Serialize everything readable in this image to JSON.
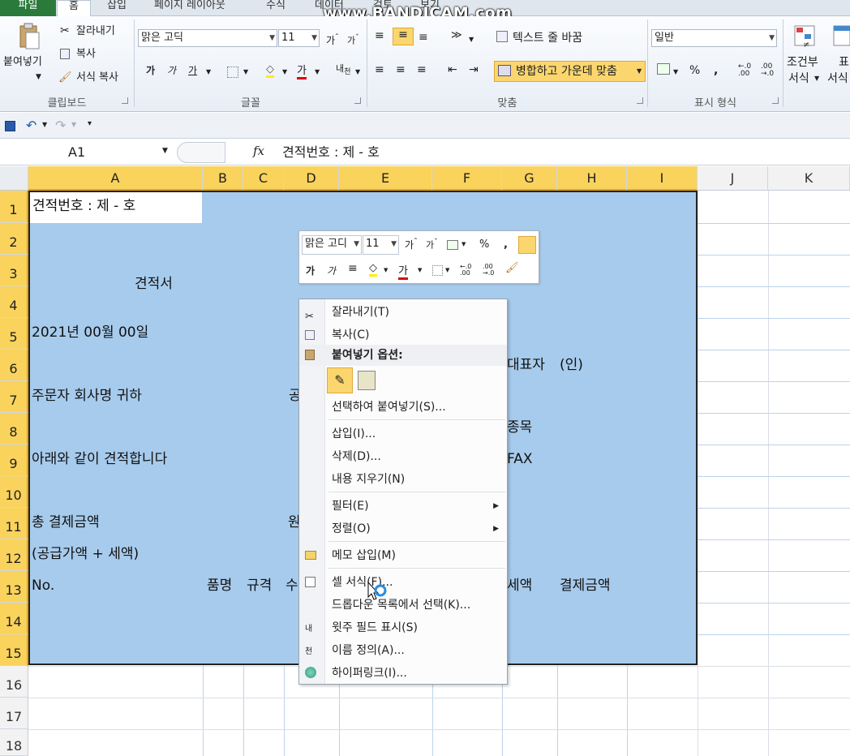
{
  "ribbon_tabs": [
    "파일",
    "홈",
    "삽입",
    "페이지 레이아웃",
    "수식",
    "데이터",
    "검토",
    "보기"
  ],
  "watermark": "www.BANDICAM.com",
  "clipboard": {
    "paste": "붙여넣기",
    "cut": "잘라내기",
    "copy": "복사",
    "format_painter": "서식 복사",
    "label": "클립보드"
  },
  "font": {
    "name": "맑은 고딕",
    "size": "11",
    "bold": "가",
    "italic": "가",
    "underline": "가",
    "label": "글꼴"
  },
  "alignment": {
    "wrap": "텍스트 줄 바꿈",
    "merge": "병합하고 가운데 맞춤",
    "label": "맞춤"
  },
  "number": {
    "format": "일반",
    "percent": "%",
    "comma": ",",
    "label": "표시 형식"
  },
  "styles": {
    "conditional_1": "조건부",
    "conditional_2": "서식",
    "table_1": "표",
    "table_2": "서식"
  },
  "name_box": "A1",
  "fx": "fx",
  "formula": "견적번호 : 제  -  호",
  "columns": [
    "A",
    "B",
    "C",
    "D",
    "E",
    "F",
    "G",
    "H",
    "I",
    "J",
    "K"
  ],
  "rows": [
    "1",
    "2",
    "3",
    "4",
    "5",
    "6",
    "7",
    "8",
    "9",
    "10",
    "11",
    "12",
    "13",
    "14",
    "15",
    "16",
    "17",
    "18"
  ],
  "cells": {
    "a1": "견적번호 : 제  -  호",
    "title": "견적서",
    "date": "2021년    00월    00일",
    "rep": "대표자",
    "seal": "(인)",
    "orderer": "주문자 회사명     귀하",
    "d7": "공",
    "item_type": "종목",
    "notice": "아래와 같이 견적합니다",
    "fax": "FAX",
    "total": "총 결제금액",
    "won": "원",
    "supply": "(공급가액 + 세액)",
    "no": "No.",
    "item": "품명",
    "spec": "규격",
    "qty": "수",
    "tax": "세액",
    "pay": "결제금액"
  },
  "mini_toolbar": {
    "font": "맑은 고디",
    "size": "11",
    "percent": "%",
    "comma": ",",
    "bold": "가",
    "italic": "가",
    "font_color": "가"
  },
  "context_menu": {
    "cut": "잘라내기(T)",
    "copy": "복사(C)",
    "paste_options": "붙여넣기 옵션:",
    "paste_special": "선택하여 붙여넣기(S)...",
    "insert": "삽입(I)...",
    "delete": "삭제(D)...",
    "clear": "내용 지우기(N)",
    "filter": "필터(E)",
    "sort": "정렬(O)",
    "comment": "메모 삽입(M)",
    "format_cells": "셀 서식(F)...",
    "dropdown": "드롭다운 목록에서 선택(K)...",
    "phonetic": "윗주 필드 표시(S)",
    "define_name": "이름 정의(A)...",
    "hyperlink": "하이퍼링크(I)...",
    "phonetic_icon": "내천"
  }
}
